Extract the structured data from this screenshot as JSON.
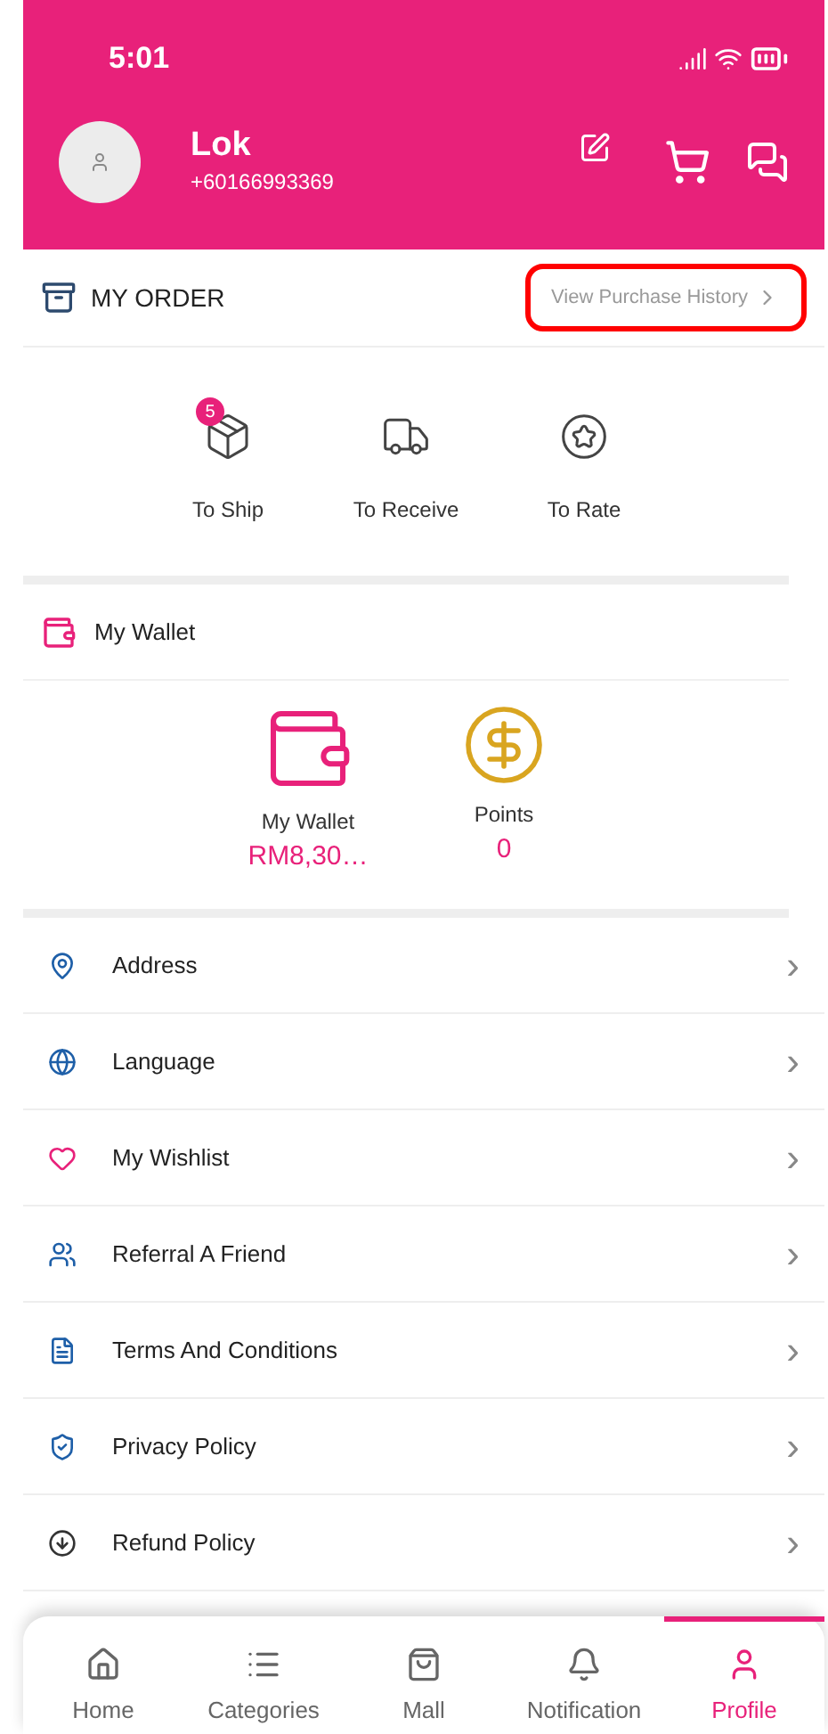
{
  "status_bar": {
    "time": "5:01"
  },
  "profile": {
    "name": "Lok",
    "phone": "+60166993369"
  },
  "my_order": {
    "title": "MY ORDER",
    "link": "View Purchase History",
    "highlighted": true,
    "items": [
      {
        "label": "To Ship",
        "badge": "5"
      },
      {
        "label": "To Receive"
      },
      {
        "label": "To Rate"
      }
    ]
  },
  "wallet": {
    "title": "My Wallet",
    "items": [
      {
        "label": "My Wallet",
        "value": "RM8,30…"
      },
      {
        "label": "Points",
        "value": "0"
      }
    ]
  },
  "menu": [
    {
      "label": "Address",
      "chevron": "›"
    },
    {
      "label": "Language",
      "chevron": "›"
    },
    {
      "label": "My Wishlist",
      "chevron": "›"
    },
    {
      "label": "Referral A Friend",
      "chevron": "›"
    },
    {
      "label": "Terms And Conditions",
      "chevron": "›"
    },
    {
      "label": "Privacy Policy",
      "chevron": "›"
    },
    {
      "label": "Refund Policy",
      "chevron": "›"
    }
  ],
  "tab_bar": [
    {
      "label": "Home",
      "selected": false
    },
    {
      "label": "Categories",
      "selected": false
    },
    {
      "label": "Mall",
      "selected": false
    },
    {
      "label": "Notification",
      "selected": false
    },
    {
      "label": "Profile",
      "selected": true
    }
  ]
}
